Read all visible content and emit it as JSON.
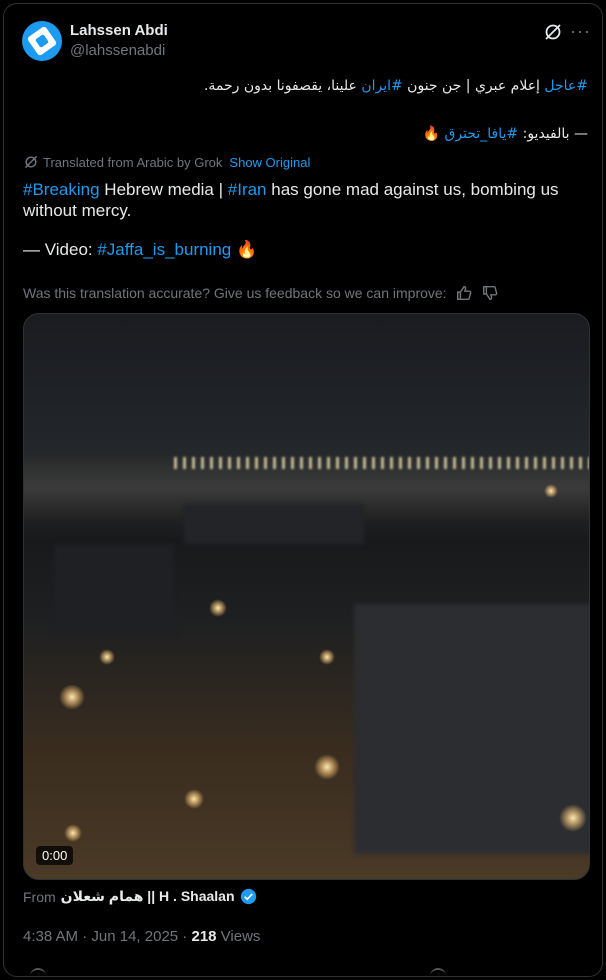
{
  "author": {
    "name": "Lahssen Abdi",
    "handle": "@lahssenabdi"
  },
  "tweet": {
    "arabic_tag1": "#عاجل",
    "arabic_mid1": " إعلام عبري | جن جنون ",
    "arabic_tag2": "#ايران",
    "arabic_mid2": " علينا، يقصفونا بدون رحمة.",
    "arabic_video_prefix": "— بالفيديو: ",
    "arabic_tag3": "#يافا_تحترق",
    "fire_emoji": "🔥",
    "translated_label": "Translated from Arabic by Grok",
    "show_original_label": "Show Original",
    "en_tag1": "#Breaking",
    "en_text1": " Hebrew media | ",
    "en_tag2": "#Iran",
    "en_text2": " has gone mad against us, bombing us without mercy.",
    "en_video_prefix": "— Video: ",
    "en_tag3": "#Jaffa_is_burning",
    "feedback_text": "Was this translation accurate? Give us feedback so we can improve:"
  },
  "video": {
    "time": "0:00"
  },
  "source": {
    "from_label": "From",
    "name": "همام شعلان || H . Shaalan"
  },
  "meta": {
    "time": "4:38 AM",
    "separator1": " · ",
    "date": "Jun 14, 2025",
    "separator2": " · ",
    "views_count": "218",
    "views_label": " Views"
  },
  "colors": {
    "link": "#1d9bf0",
    "muted": "#71767b",
    "text": "#e7e9ea",
    "background": "#000000"
  }
}
